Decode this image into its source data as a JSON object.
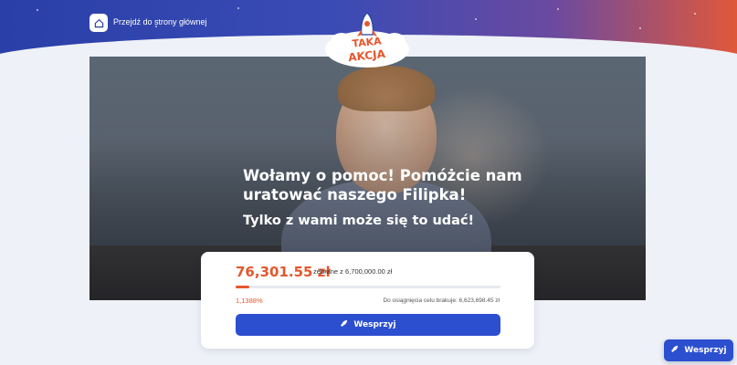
{
  "header": {
    "home_label": "Przejdź do strony głównej",
    "logo_text_line1": "TAKA",
    "logo_text_line2": "AKCJA",
    "gradient_colors": [
      "#2a3fa8",
      "#6a4aa0",
      "#e0583a"
    ]
  },
  "hero": {
    "title": "Wołamy o pomoc! Pomóżcie nam uratować naszego Filipka!",
    "subtitle": "Tylko z wami może się to udać!"
  },
  "donation": {
    "amount": "76,301.55 zł",
    "goal_text": "zebrane z 6,700,000.00 zł",
    "percent_text": "1,1388%",
    "progress_fraction": 0.011388,
    "missing_text": "Do osiągnięcia celu brakuje: 6,623,698.45 zł",
    "button_label": "Wesprzyj"
  },
  "floating_button": {
    "label": "Wesprzyj"
  },
  "colors": {
    "accent": "#e4572e",
    "primary": "#2c4fd0",
    "background": "#eef1f7"
  },
  "icons": {
    "home": "home-icon",
    "rocket": "rocket-icon"
  }
}
